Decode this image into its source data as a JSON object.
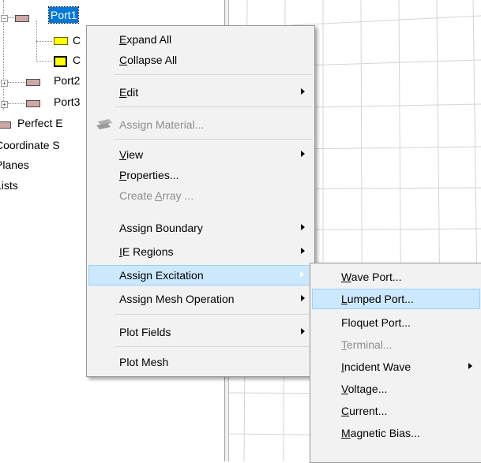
{
  "tree": {
    "port1": "Port1",
    "child1": "C",
    "child2": "C",
    "port2": "Port2",
    "port3": "Port3",
    "perfect_e": "Perfect E",
    "coordinate": "Coordinate S",
    "planes": "Planes",
    "lists": "Lists"
  },
  "context_menu": {
    "items": [
      {
        "label": "Expand All",
        "accel": "E",
        "enabled": true,
        "submenu": false
      },
      {
        "label": "Collapse All",
        "accel": "C",
        "enabled": true,
        "submenu": false
      },
      {
        "label": "Edit",
        "accel": "E",
        "enabled": true,
        "submenu": true
      },
      {
        "label": "Assign Material...",
        "accel": "",
        "enabled": false,
        "submenu": false,
        "icon": "material-icon"
      },
      {
        "label": "View",
        "accel": "V",
        "enabled": true,
        "submenu": true
      },
      {
        "label": "Properties...",
        "accel": "P",
        "enabled": true,
        "submenu": false
      },
      {
        "label": "Create Array ...",
        "accel": "A",
        "enabled": false,
        "submenu": false
      },
      {
        "label": "Assign Boundary",
        "accel": "",
        "enabled": true,
        "submenu": true
      },
      {
        "label": "IE Regions",
        "accel": "I",
        "enabled": true,
        "submenu": true
      },
      {
        "label": "Assign Excitation",
        "accel": "",
        "enabled": true,
        "submenu": true,
        "highlighted": true
      },
      {
        "label": "Assign Mesh Operation",
        "accel": "",
        "enabled": true,
        "submenu": true
      },
      {
        "label": "Plot Fields",
        "accel": "",
        "enabled": true,
        "submenu": true
      },
      {
        "label": "Plot Mesh",
        "accel": "",
        "enabled": true,
        "submenu": false
      }
    ]
  },
  "excitation_submenu": {
    "items": [
      {
        "label": "Wave Port...",
        "accel": "W",
        "enabled": true,
        "submenu": false
      },
      {
        "label": "Lumped Port...",
        "accel": "L",
        "enabled": true,
        "submenu": false,
        "highlighted": true
      },
      {
        "label": "Floquet Port...",
        "accel": "",
        "enabled": true,
        "submenu": false
      },
      {
        "label": "Terminal...",
        "accel": "T",
        "enabled": false,
        "submenu": false
      },
      {
        "label": "Incident Wave",
        "accel": "I",
        "enabled": true,
        "submenu": true
      },
      {
        "label": "Voltage...",
        "accel": "V",
        "enabled": true,
        "submenu": false
      },
      {
        "label": "Current...",
        "accel": "C",
        "enabled": true,
        "submenu": false
      },
      {
        "label": "Magnetic Bias...",
        "accel": "M",
        "enabled": true,
        "submenu": false
      }
    ]
  },
  "colors": {
    "selection": "#0078d7",
    "menu_bg": "#f2f2f2",
    "menu_highlight": "#cce8ff",
    "menu_highlight_border": "#99d1ff",
    "disabled_text": "#8d8d8d",
    "face_yellow": "#ffff00",
    "port_icon": "#cfa7a7"
  }
}
